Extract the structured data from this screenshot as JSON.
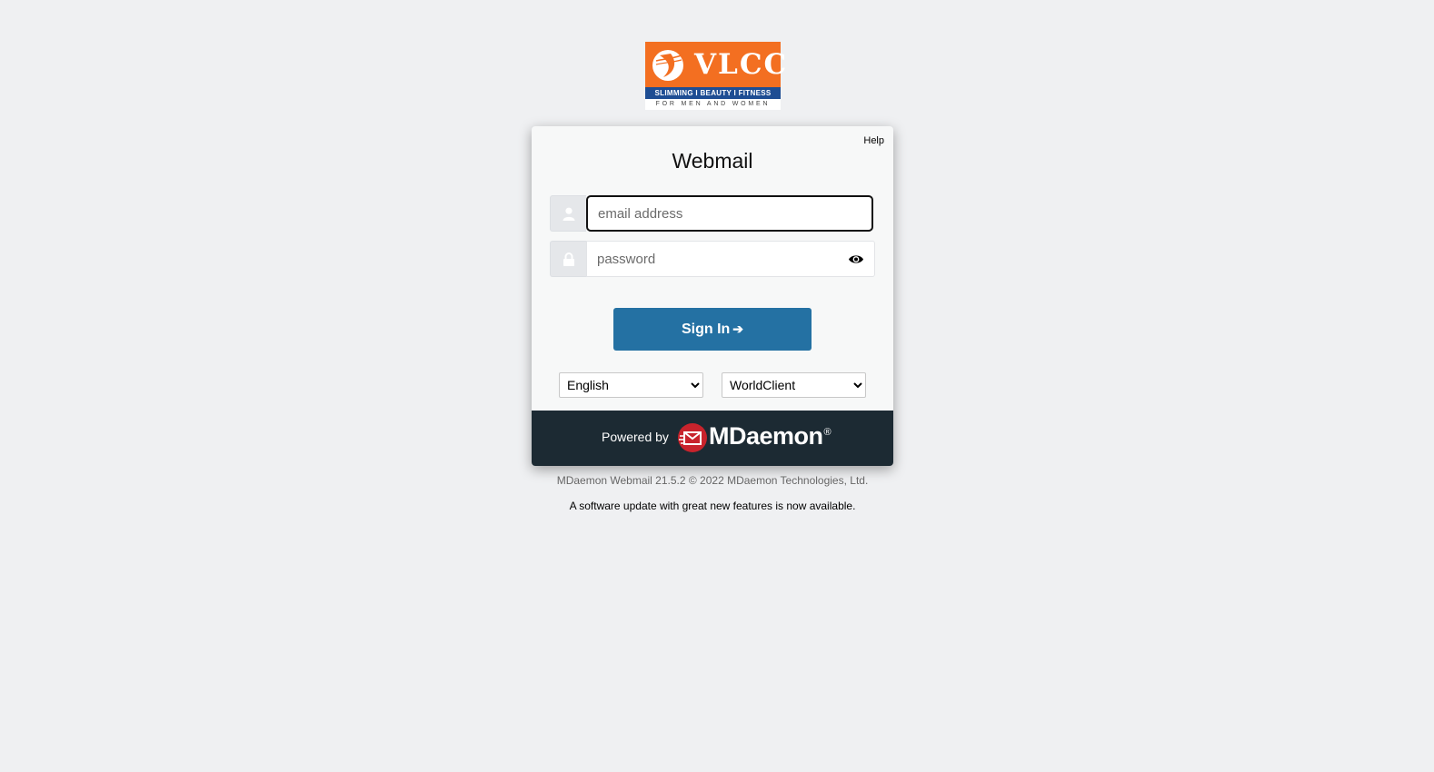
{
  "brand": {
    "name": "VLCC",
    "tagline": "SLIMMING I BEAUTY I FITNESS",
    "subtagline": "FOR MEN AND WOMEN"
  },
  "login": {
    "help_label": "Help",
    "title": "Webmail",
    "email_placeholder": "email address",
    "email_value": "",
    "password_placeholder": "password",
    "password_value": "",
    "signin_label": "Sign In",
    "signin_arrow": "➔",
    "language_selected": "English",
    "theme_selected": "WorldClient",
    "icons": {
      "user": "user-icon",
      "lock": "lock-icon",
      "show_password": "eye-icon"
    }
  },
  "footer": {
    "powered_by": "Powered by",
    "vendor": "MDaemon",
    "registered": "®",
    "version_text": "MDaemon Webmail 21.5.2 © 2022 MDaemon Technologies, Ltd.",
    "update_notice": "A software update with great new features is now available."
  },
  "colors": {
    "background": "#eff0f2",
    "brand_orange": "#f36f21",
    "brand_blue": "#1e4d93",
    "signin_blue": "#2471a3",
    "footer_dark": "#1c2a33",
    "mdaemon_red": "#c8232c"
  }
}
